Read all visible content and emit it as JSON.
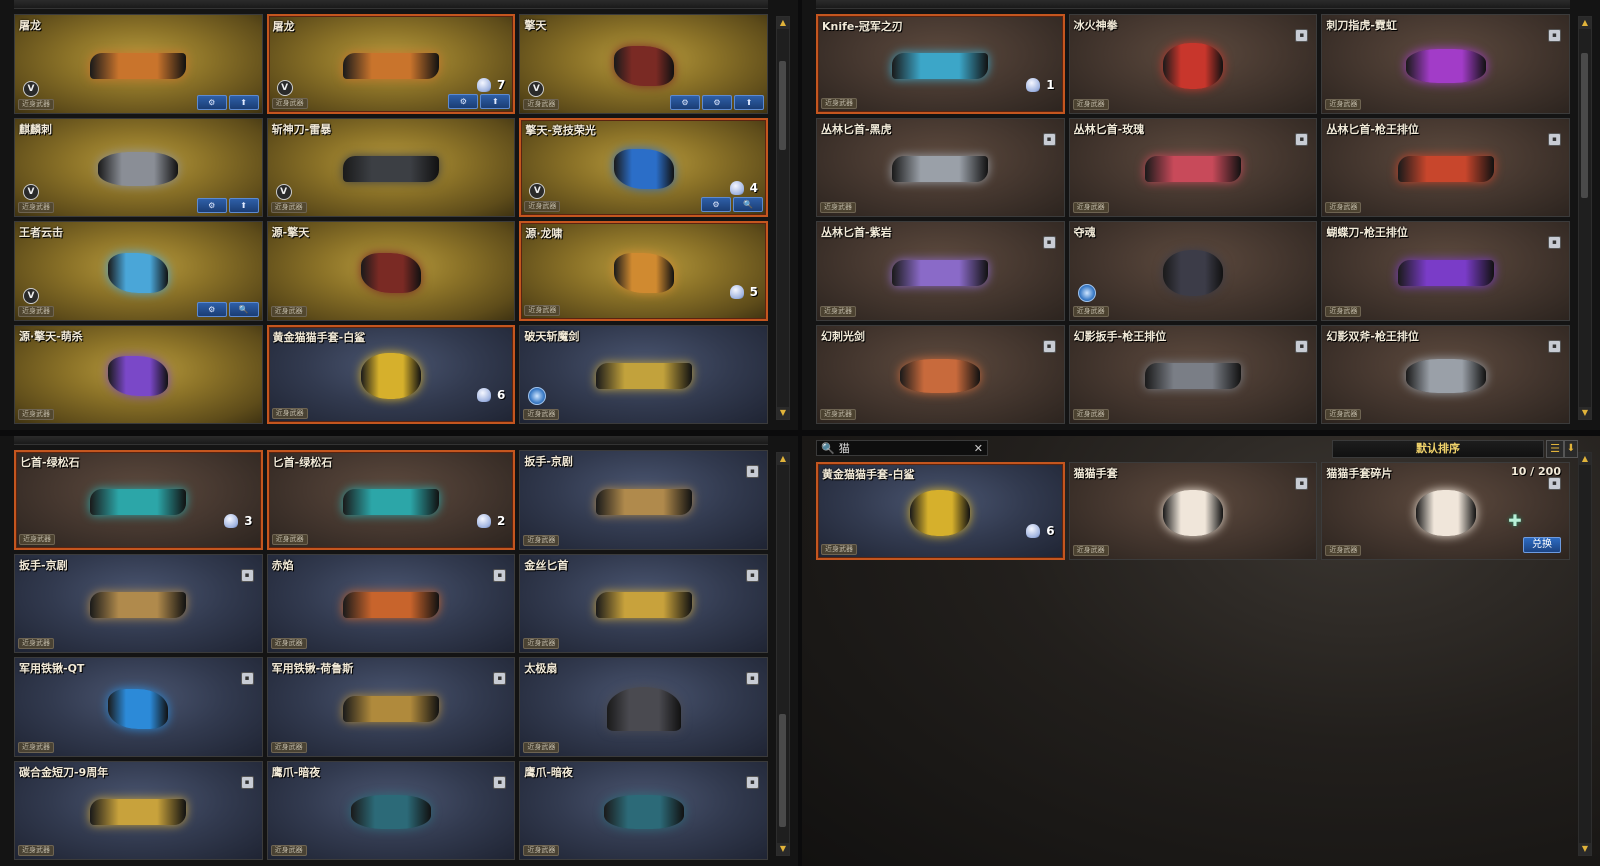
{
  "common": {
    "tag_label": "近身武器",
    "v_badge": "V",
    "lock_glyph": "▪",
    "scroll_up": "▲",
    "scroll_down": "▼"
  },
  "panel_tl": {
    "cards": [
      {
        "name": "屠龙",
        "style": "gold",
        "icon_color": "#c9742c",
        "v": true,
        "buttons": [
          "⚙",
          "⬆"
        ]
      },
      {
        "name": "屠龙",
        "style": "gold",
        "selected": true,
        "icon_color": "#c9742c",
        "v": true,
        "qty": "7",
        "buttons": [
          "⚙",
          "⬆"
        ]
      },
      {
        "name": "擎天",
        "style": "gold",
        "icon_color": "#7a2a24",
        "v": true,
        "buttons": [
          "⚙",
          "⚙",
          "⬆"
        ],
        "shape": "axe"
      },
      {
        "name": "麒麟刺",
        "style": "gold",
        "icon_color": "#8a8e96",
        "v": true,
        "buttons": [
          "⚙",
          "⬆"
        ],
        "shape": "pair"
      },
      {
        "name": "斩神刀-雷暴",
        "style": "gold",
        "icon_color": "#3c3f44",
        "v": true
      },
      {
        "name": "擎天-竞技荣光",
        "style": "gold",
        "selected": true,
        "icon_color": "#2b6ec8",
        "v": true,
        "qty": "4",
        "buttons": [
          "⚙",
          "🔍"
        ],
        "shape": "axe"
      },
      {
        "name": "王者云击",
        "style": "gold",
        "icon_color": "#4aa6d8",
        "v": true,
        "buttons": [
          "⚙",
          "🔍"
        ],
        "shape": "axe"
      },
      {
        "name": "源-擎天",
        "style": "gold",
        "icon_color": "#7a2a24",
        "shape": "axe"
      },
      {
        "name": "源·龙啸",
        "style": "gold",
        "selected": true,
        "icon_color": "#d08a30",
        "qty": "5",
        "shape": "axe"
      },
      {
        "name": "源·擎天-萌杀",
        "style": "gold",
        "icon_color": "#7a48c8",
        "shape": "axe"
      },
      {
        "name": "黄金猫猫手套-白鲨",
        "style": "blue",
        "selected": true,
        "icon_color": "#d6b02c",
        "qty": "6",
        "shape": "glove"
      },
      {
        "name": "破天斩魔剑",
        "style": "blue",
        "icon_color": "#c2a23c",
        "circle": true
      }
    ],
    "scroll_thumb_top": "8%",
    "scroll_thumb_height": "22%"
  },
  "panel_tr": {
    "cards": [
      {
        "name": "Knife-冠军之刃",
        "style": "brown",
        "selected": true,
        "icon_color": "#3ca6c8",
        "qty": "1"
      },
      {
        "name": "冰火神拳",
        "style": "brown",
        "icon_color": "#c8362c",
        "lock": true,
        "shape": "glove"
      },
      {
        "name": "刺刀指虎-霓虹",
        "style": "brown",
        "icon_color": "#a23cc8",
        "lock": true,
        "shape": "pair"
      },
      {
        "name": "丛林匕首-黑虎",
        "style": "brown",
        "icon_color": "#9aa0a8",
        "lock": true
      },
      {
        "name": "丛林匕首-玫瑰",
        "style": "brown",
        "icon_color": "#c84a5a",
        "lock": true
      },
      {
        "name": "丛林匕首-枪王排位",
        "style": "brown",
        "icon_color": "#c8462c",
        "lock": true
      },
      {
        "name": "丛林匕首-紫岩",
        "style": "brown",
        "icon_color": "#8a6ac8",
        "lock": true
      },
      {
        "name": "夺魂",
        "style": "brown",
        "icon_color": "#3c3c48",
        "circle": true,
        "shape": "glove"
      },
      {
        "name": "蝴蝶刀-枪王排位",
        "style": "brown",
        "icon_color": "#7a3cc8",
        "lock": true
      },
      {
        "name": "幻刺光剑",
        "style": "brown",
        "icon_color": "#c86a3c",
        "lock": true,
        "shape": "pair"
      },
      {
        "name": "幻影扳手-枪王排位",
        "style": "brown",
        "icon_color": "#7a7e86",
        "lock": true
      },
      {
        "name": "幻影双斧-枪王排位",
        "style": "brown",
        "icon_color": "#9aa0a8",
        "lock": true,
        "shape": "pair"
      }
    ],
    "scroll_thumb_top": "6%",
    "scroll_thumb_height": "36%"
  },
  "panel_bl": {
    "cards": [
      {
        "name": "匕首-绿松石",
        "style": "brown",
        "selected": true,
        "icon_color": "#2ca6a8",
        "qty": "3"
      },
      {
        "name": "匕首-绿松石",
        "style": "brown",
        "selected": true,
        "icon_color": "#2ca6a8",
        "qty": "2"
      },
      {
        "name": "扳手-京剧",
        "style": "blue",
        "icon_color": "#b08a4c",
        "lock": true
      },
      {
        "name": "扳手-京剧",
        "style": "blue",
        "icon_color": "#b08a4c",
        "lock": true
      },
      {
        "name": "赤焰",
        "style": "blue",
        "icon_color": "#c8642c",
        "lock": true
      },
      {
        "name": "金丝匕首",
        "style": "blue",
        "icon_color": "#c8a23c",
        "lock": true
      },
      {
        "name": "军用铁锹-QT",
        "style": "blue",
        "icon_color": "#2c8ad8",
        "lock": true,
        "shape": "axe"
      },
      {
        "name": "军用铁锹-荷鲁斯",
        "style": "blue",
        "icon_color": "#b08a3c",
        "lock": true
      },
      {
        "name": "太极扇",
        "style": "blue",
        "icon_color": "#4a4a50",
        "lock": true,
        "shape": "fan"
      },
      {
        "name": "碳合金短刀-9周年",
        "style": "blue",
        "icon_color": "#c8a23c",
        "lock": true
      },
      {
        "name": "鹰爪-暗夜",
        "style": "blue",
        "icon_color": "#2c6a78",
        "lock": true,
        "shape": "pair"
      },
      {
        "name": "鹰爪-暗夜",
        "style": "blue",
        "icon_color": "#2c6a78",
        "lock": true,
        "shape": "pair"
      }
    ],
    "scroll_thumb_top": "62%",
    "scroll_thumb_height": "28%"
  },
  "panel_br": {
    "search": {
      "icon": "🔍",
      "value": "猫",
      "clear": "✕"
    },
    "sort_label": "默认排序",
    "list_icon": "☰",
    "down_icon": "⬇",
    "cards": [
      {
        "name": "黄金猫猫手套-白鲨",
        "style": "blue",
        "selected": true,
        "icon_color": "#d6b02c",
        "qty": "6",
        "shape": "glove"
      },
      {
        "name": "猫猫手套",
        "style": "brown",
        "icon_color": "#f0e6da",
        "lock": true,
        "shape": "glove"
      },
      {
        "name": "猫猫手套碎片",
        "style": "brown",
        "icon_color": "#f0e6da",
        "count": "10 / 200",
        "lock": true,
        "redeem": "兑换",
        "plus": "✚",
        "shape": "glove"
      }
    ]
  }
}
